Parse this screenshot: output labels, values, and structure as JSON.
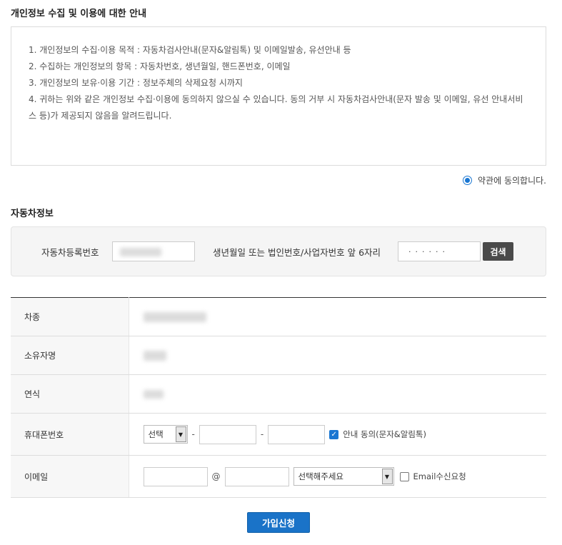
{
  "privacy": {
    "title": "개인정보 수집 및 이용에 대한 안내",
    "terms": [
      "1. 개인정보의 수집·이용 목적 : 자동차검사안내(문자&알림톡) 및 이메일발송, 유선안내 등",
      "2. 수집하는 개인정보의 항목 : 자동차번호, 생년월일, 핸드폰번호, 이메일",
      "3. 개인정보의 보유·이용 기간 : 정보주체의 삭제요청 시까지",
      "4. 귀하는 위와 같은 개인정보 수집·이용에 동의하지 않으실 수 있습니다. 동의 거부 시 자동차검사안내(문자 발송 및 이메일, 유선 안내서비스 등)가 제공되지 않음을 알려드립니다."
    ],
    "agree_label": "약관에 동의합니다.",
    "agree_checked": true
  },
  "car": {
    "title": "자동차정보",
    "reg_label": "자동차등록번호",
    "birth_label": "생년월일 또는 법인번호/사업자번호 앞 6자리",
    "birth_value": "······",
    "search_label": "검색"
  },
  "table": {
    "rows": {
      "model": "차종",
      "owner": "소유자명",
      "year": "연식",
      "phone": "휴대폰번호",
      "email": "이메일"
    },
    "phone_select": "선택",
    "dash": "-",
    "sms_consent": "안내 동의(문자&알림톡)",
    "sms_checked": true,
    "at_sign": "@",
    "email_domain_select": "선택해주세요",
    "email_consent": "Email수신요청",
    "email_checked": false
  },
  "submit_label": "가입신청",
  "colors": {
    "accent": "#1976d2",
    "submit": "#1a73c8",
    "search_btn": "#4a4a4a"
  }
}
